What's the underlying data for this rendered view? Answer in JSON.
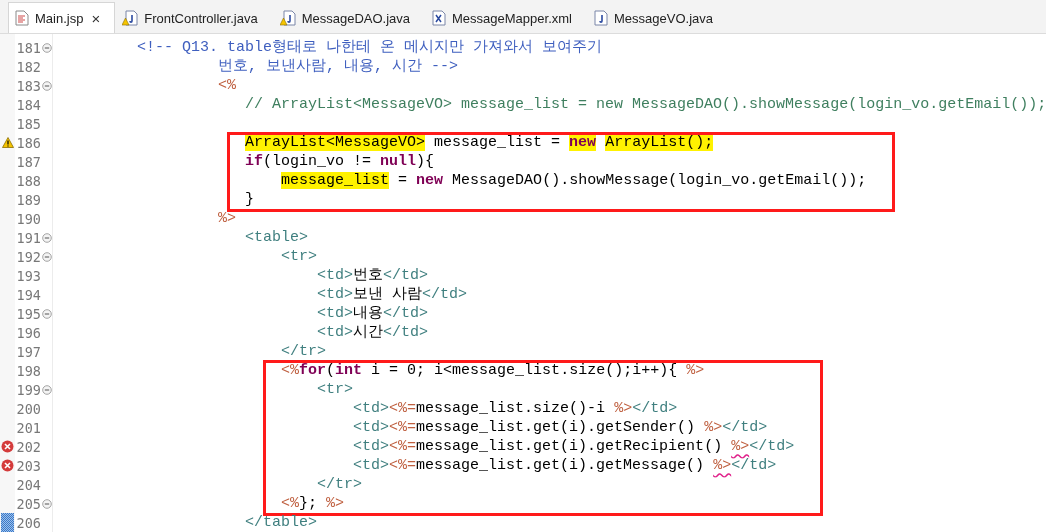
{
  "tabs": [
    {
      "label": "Main.jsp",
      "kind": "jsp",
      "selected": true,
      "close": "×"
    },
    {
      "label": "FrontController.java",
      "kind": "java-warning",
      "selected": false
    },
    {
      "label": "MessageDAO.java",
      "kind": "java-warning",
      "selected": false
    },
    {
      "label": "MessageMapper.xml",
      "kind": "xml",
      "selected": false
    },
    {
      "label": "MessageVO.java",
      "kind": "java",
      "selected": false
    }
  ],
  "editor": {
    "segments": [
      {
        "boxed": false,
        "lines": [
          {
            "number": "181",
            "fold": true,
            "tokens": [
              {
                "text": "         <!-- Q13. table형태로 나한테 온 메시지만 가져와서 보여주기",
                "kind": "html-comment"
              }
            ]
          },
          {
            "number": "182",
            "fold": false,
            "tokens": [
              {
                "text": "                  번호, 보낸사람, 내용, 시간 -->",
                "kind": "html-comment"
              }
            ]
          },
          {
            "number": "183",
            "fold": true,
            "tokens": [
              {
                "text": "                  <%",
                "kind": "jsp"
              }
            ]
          },
          {
            "number": "184",
            "fold": false,
            "tokens": [
              {
                "text": "                     // ArrayList<MessageVO> message_list = new MessageDAO().showMessage(login_vo.getEmail());",
                "kind": "java-comment"
              }
            ]
          },
          {
            "number": "185",
            "fold": false
          }
        ]
      },
      {
        "boxed": true,
        "lines": [
          {
            "number": "186",
            "fold": false,
            "marker": {
              "kind": "warning"
            },
            "tokens": [
              {
                "text": "                     ArrayList<MessageVO>",
                "kind": "plain",
                "highlighted": true
              },
              {
                "text": " message_list = ",
                "kind": "plain",
                "highlighted": false
              },
              {
                "text": "new",
                "kind": "keyword",
                "highlighted": true
              },
              {
                "text": " ArrayList();",
                "kind": "plain",
                "highlighted": true
              }
            ]
          },
          {
            "number": "187",
            "fold": false,
            "tokens": [
              {
                "text": "                     if",
                "kind": "keyword"
              },
              {
                "text": "(login_vo != ",
                "kind": "plain"
              },
              {
                "text": "null",
                "kind": "keyword"
              },
              {
                "text": "){",
                "kind": "plain"
              }
            ]
          },
          {
            "number": "188",
            "fold": false,
            "tokens": [
              {
                "text": "                         message_list",
                "kind": "plain",
                "highlighted": true
              },
              {
                "text": " = ",
                "kind": "plain",
                "highlighted": false
              },
              {
                "text": "new",
                "kind": "keyword"
              },
              {
                "text": " MessageDAO().showMessage(login_vo.getEmail());",
                "kind": "plain"
              }
            ]
          },
          {
            "number": "189",
            "fold": false,
            "tokens": [
              {
                "text": "                     }",
                "kind": "plain"
              }
            ]
          }
        ]
      },
      {
        "boxed": false,
        "lines": [
          {
            "number": "190",
            "fold": false,
            "tokens": [
              {
                "text": "                  %>",
                "kind": "jsp"
              }
            ]
          },
          {
            "number": "191",
            "fold": true,
            "tokens": [
              {
                "text": "                     <table>",
                "kind": "tag"
              }
            ]
          },
          {
            "number": "192",
            "fold": true,
            "tokens": [
              {
                "text": "                         <tr>",
                "kind": "tag"
              }
            ]
          },
          {
            "number": "193",
            "fold": false,
            "tokens": [
              {
                "text": "                             <td>",
                "kind": "tag"
              },
              {
                "text": "번호",
                "kind": "plain"
              },
              {
                "text": "</td>",
                "kind": "tag"
              }
            ]
          },
          {
            "number": "194",
            "fold": false,
            "tokens": [
              {
                "text": "                             <td>",
                "kind": "tag"
              },
              {
                "text": "보낸 사람",
                "kind": "plain"
              },
              {
                "text": "</td>",
                "kind": "tag"
              }
            ]
          },
          {
            "number": "195",
            "fold": true,
            "tokens": [
              {
                "text": "                             <td>",
                "kind": "tag"
              },
              {
                "text": "내용",
                "kind": "plain"
              },
              {
                "text": "</td>",
                "kind": "tag"
              }
            ]
          },
          {
            "number": "196",
            "fold": false,
            "tokens": [
              {
                "text": "                             <td>",
                "kind": "tag"
              },
              {
                "text": "시간",
                "kind": "plain"
              },
              {
                "text": "</td>",
                "kind": "tag"
              }
            ]
          },
          {
            "number": "197",
            "fold": false,
            "tokens": [
              {
                "text": "                         </tr>",
                "kind": "tag"
              }
            ]
          }
        ]
      },
      {
        "boxed": true,
        "lines": [
          {
            "number": "198",
            "fold": false,
            "tokens": [
              {
                "text": "                         <%",
                "kind": "jsp"
              },
              {
                "text": "for",
                "kind": "keyword"
              },
              {
                "text": "(",
                "kind": "plain"
              },
              {
                "text": "int",
                "kind": "keyword"
              },
              {
                "text": " i = 0; i<message_list.size();i++){ ",
                "kind": "plain"
              },
              {
                "text": "%>",
                "kind": "jsp"
              }
            ]
          },
          {
            "number": "199",
            "fold": true,
            "tokens": [
              {
                "text": "                             <tr>",
                "kind": "tag"
              }
            ]
          },
          {
            "number": "200",
            "fold": false,
            "tokens": [
              {
                "text": "                                 <td>",
                "kind": "tag"
              },
              {
                "text": "<%=",
                "kind": "jsp"
              },
              {
                "text": "message_list.size()-i ",
                "kind": "plain"
              },
              {
                "text": "%>",
                "kind": "jsp"
              },
              {
                "text": "</td>",
                "kind": "tag"
              }
            ]
          },
          {
            "number": "201",
            "fold": false,
            "tokens": [
              {
                "text": "                                 <td>",
                "kind": "tag"
              },
              {
                "text": "<%=",
                "kind": "jsp"
              },
              {
                "text": "message_list.get(i).getSender() ",
                "kind": "plain"
              },
              {
                "text": "%>",
                "kind": "jsp",
                "squiggle": false
              },
              {
                "text": "</td>",
                "kind": "tag"
              }
            ]
          },
          {
            "number": "202",
            "fold": false,
            "marker": {
              "kind": "error"
            },
            "tokens": [
              {
                "text": "                                 <td>",
                "kind": "tag"
              },
              {
                "text": "<%=",
                "kind": "jsp"
              },
              {
                "text": "message_list.get(i).getRecipient() ",
                "kind": "plain"
              },
              {
                "text": "%>",
                "kind": "jsp",
                "squiggle": true
              },
              {
                "text": "</td>",
                "kind": "tag"
              }
            ]
          },
          {
            "number": "203",
            "fold": false,
            "marker": {
              "kind": "error"
            },
            "tokens": [
              {
                "text": "                                 <td>",
                "kind": "tag"
              },
              {
                "text": "<%=",
                "kind": "jsp"
              },
              {
                "text": "message_list.get(i).getMessage() ",
                "kind": "plain"
              },
              {
                "text": "%>",
                "kind": "jsp",
                "squiggle": true
              },
              {
                "text": "</td>",
                "kind": "tag"
              }
            ]
          },
          {
            "number": "204",
            "fold": false,
            "tokens": [
              {
                "text": "                             </tr>",
                "kind": "tag"
              }
            ]
          },
          {
            "number": "205",
            "fold": true,
            "tokens": [
              {
                "text": "                         <%",
                "kind": "jsp"
              },
              {
                "text": "}; ",
                "kind": "plain"
              },
              {
                "text": "%>",
                "kind": "jsp"
              }
            ]
          }
        ]
      },
      {
        "boxed": false,
        "lines": [
          {
            "number": "206",
            "fold": false,
            "marker": {
              "kind": "change"
            },
            "tokens": [
              {
                "text": "                     </table>",
                "kind": "tag"
              }
            ]
          }
        ]
      }
    ]
  }
}
